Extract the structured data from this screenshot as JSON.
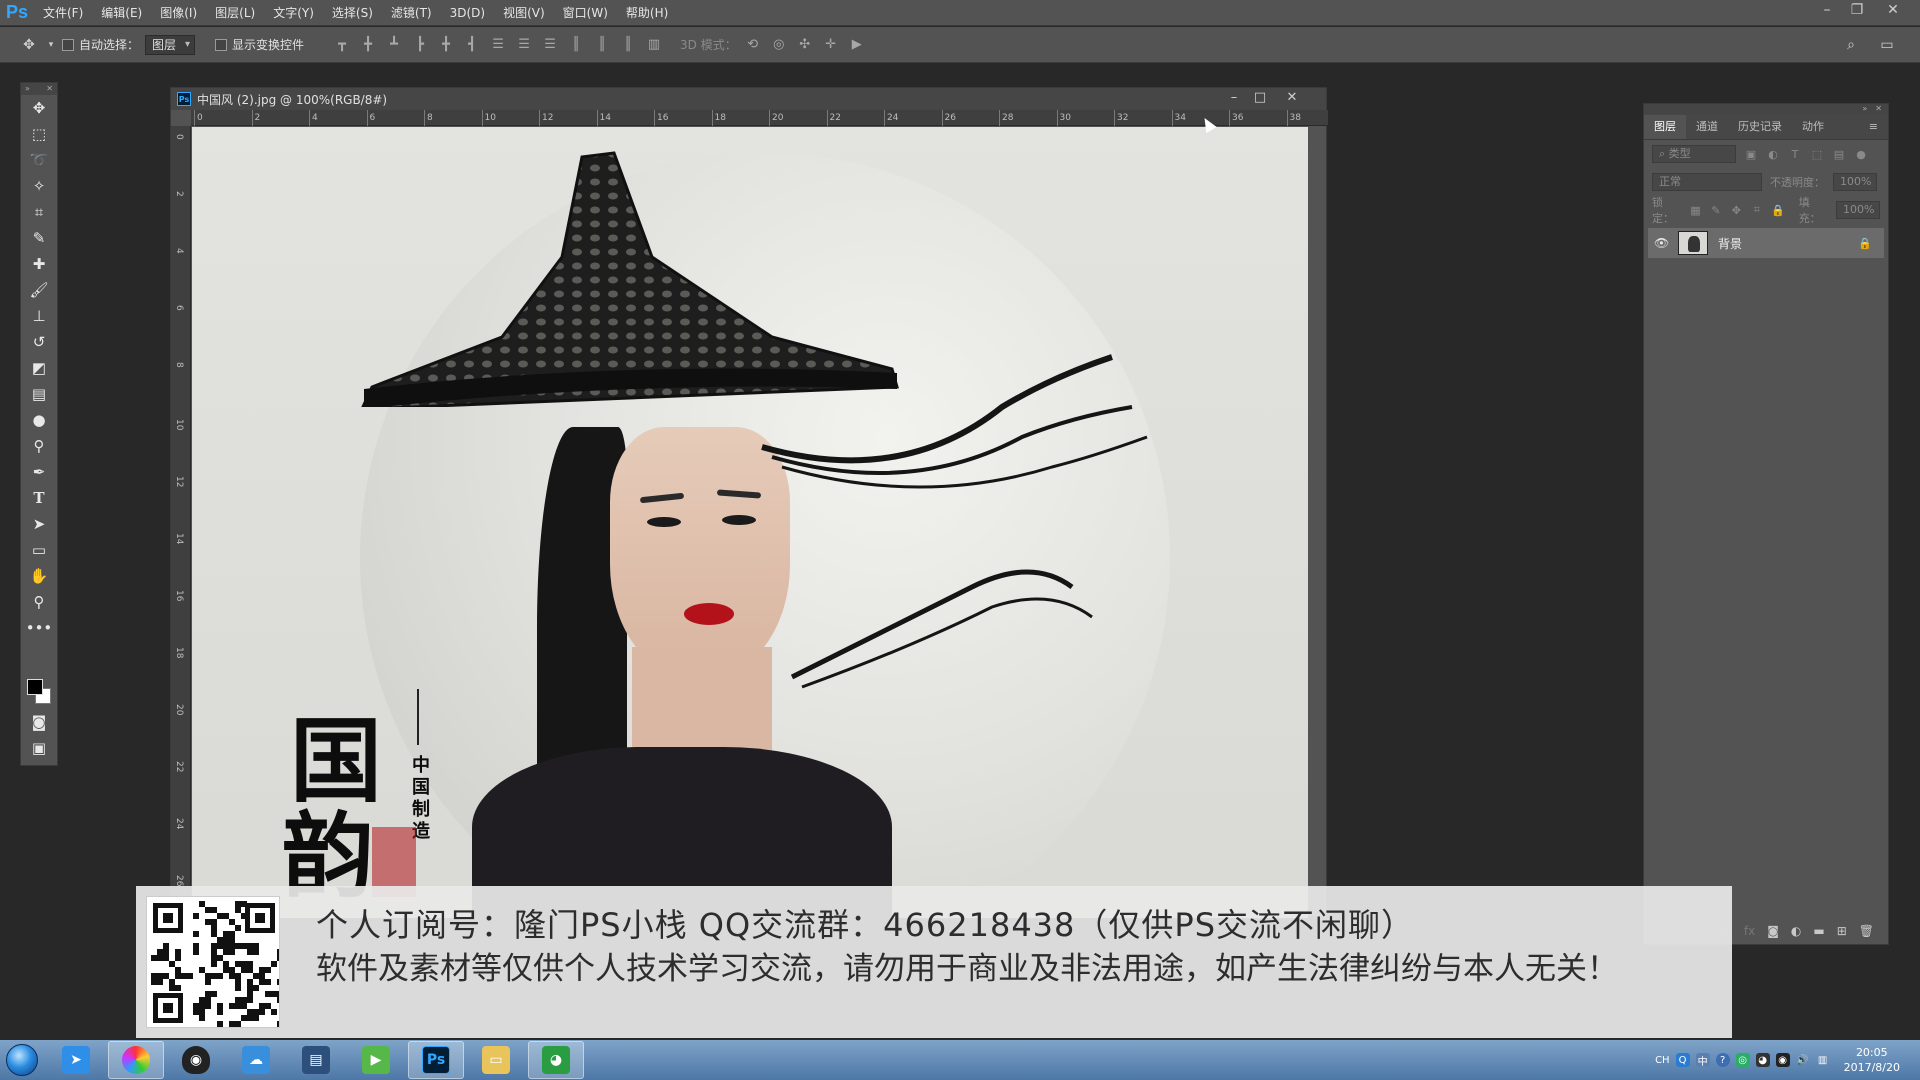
{
  "app": {
    "logo": "Ps",
    "menus": [
      "文件(F)",
      "编辑(E)",
      "图像(I)",
      "图层(L)",
      "文字(Y)",
      "选择(S)",
      "滤镜(T)",
      "3D(D)",
      "视图(V)",
      "窗口(W)",
      "帮助(H)"
    ]
  },
  "options_bar": {
    "auto_select_label": "自动选择：",
    "auto_select_value": "图层",
    "show_transform_label": "显示变换控件",
    "mode_3d_label": "3D 模式："
  },
  "document": {
    "title": "中国风 (2).jpg @ 100%(RGB/8#)",
    "ruler_top": [
      "0",
      "2",
      "4",
      "6",
      "8",
      "10",
      "12",
      "14",
      "16",
      "18",
      "20",
      "22",
      "24",
      "26",
      "28",
      "30",
      "32",
      "34",
      "36",
      "38"
    ],
    "ruler_left": [
      "0",
      "2",
      "4",
      "6",
      "8",
      "10",
      "12",
      "14",
      "16",
      "18",
      "20",
      "22",
      "24",
      "26"
    ],
    "artwork": {
      "big_chars": [
        "国",
        "韵"
      ],
      "vertical_text": "中国制造"
    }
  },
  "layers_panel": {
    "tabs": [
      "图层",
      "通道",
      "历史记录",
      "动作"
    ],
    "filter_placeholder": "类型",
    "blend_mode": "正常",
    "opacity_label": "不透明度：",
    "opacity_value": "100%",
    "lock_label": "锁定：",
    "fill_label": "填充：",
    "fill_value": "100%",
    "layers": [
      {
        "name": "背景",
        "visible": true,
        "locked": true
      }
    ]
  },
  "banner": {
    "line1": "个人订阅号：隆门PS小栈    QQ交流群：466218438（仅供PS交流不闲聊）",
    "line2": "软件及素材等仅供个人技术学习交流，请勿用于商业及非法用途，如产生法律纠纷与本人无关！"
  },
  "taskbar": {
    "apps": [
      "start-orb",
      "bird-icon",
      "color-wheel-icon",
      "qq-penguin-icon",
      "cloud-icon",
      "film-icon",
      "player-icon",
      "photoshop-icon",
      "folder-icon",
      "panda-icon"
    ],
    "tray_lang": "CH",
    "clock_time": "20:05",
    "clock_date": "2017/8/20"
  },
  "colors": {
    "ps_blue": "#31a8ff",
    "ui_bg": "#535353",
    "workspace": "#282828",
    "lips": "#b3121b"
  }
}
